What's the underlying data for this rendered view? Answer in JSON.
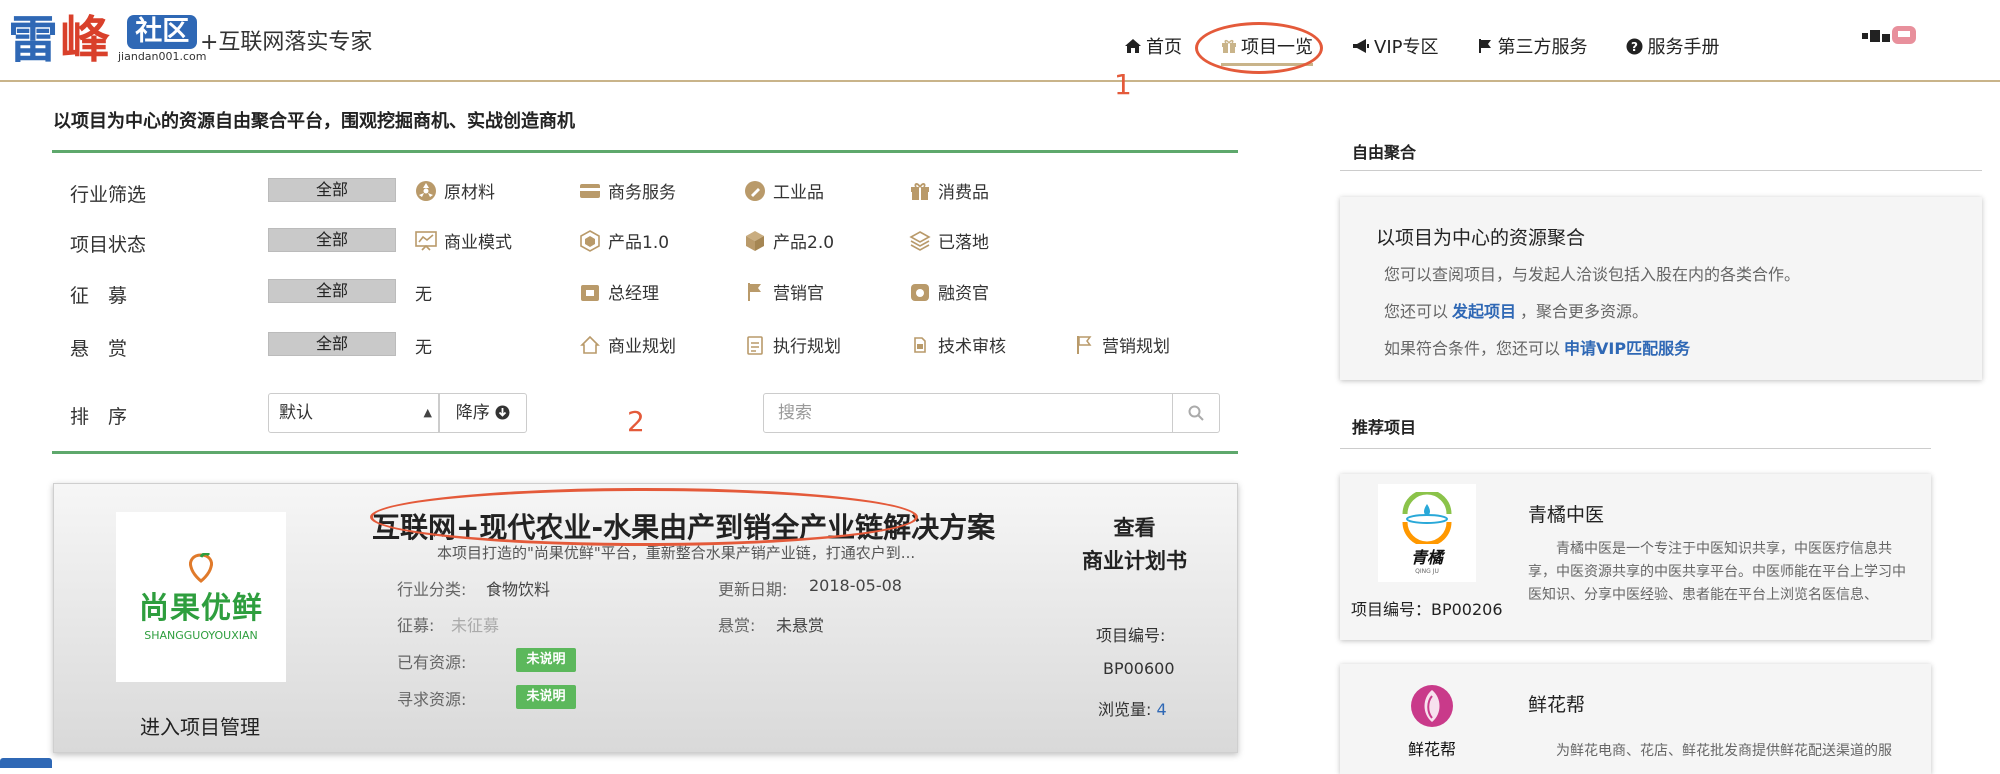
{
  "header": {
    "logo_char1": "雷",
    "logo_char2": "峰",
    "logo_box": "社区",
    "logo_url": "jiandan001.com",
    "slogan": "+互联网落实专家",
    "nav": [
      {
        "label": "首页",
        "icon": "home-icon"
      },
      {
        "label": "项目一览",
        "icon": "gift-icon"
      },
      {
        "label": "VIP专区",
        "icon": "megaphone-icon"
      },
      {
        "label": "第三方服务",
        "icon": "flag-icon"
      },
      {
        "label": "服务手册",
        "icon": "question-circle-icon"
      }
    ],
    "active_nav": "项目一览"
  },
  "annotations": {
    "num1": "1",
    "num2": "2",
    "color": "#e45a3a"
  },
  "main": {
    "tagline": "以项目为中心的资源自由聚合平台，围观挖掘商机、实战创造商机",
    "filters": {
      "all_label": "全部",
      "industry": {
        "label": "行业筛选",
        "options": [
          "原材料",
          "商务服务",
          "工业品",
          "消费品"
        ]
      },
      "status": {
        "label": "项目状态",
        "options": [
          "商业模式",
          "产品1.0",
          "产品2.0",
          "已落地"
        ]
      },
      "recruit": {
        "label": "征　募",
        "options": [
          "无",
          "总经理",
          "营销官",
          "融资官"
        ]
      },
      "reward": {
        "label": "悬　赏",
        "options": [
          "无",
          "商业规划",
          "执行规划",
          "技术审核",
          "营销规划"
        ]
      },
      "sort": {
        "label": "排　序",
        "select_value": "默认",
        "order_label": "降序"
      },
      "search_placeholder": "搜索"
    },
    "project": {
      "logo_cn": "尚果优鲜",
      "logo_en": "SHANGGUOYOUXIAN",
      "manage_label": "进入项目管理",
      "title": "互联网+现代农业-水果由产到销全产业链解决方案",
      "subtitle": "本项目打造的\"尚果优鲜\"平台，重新整合水果产销产业链，打通农户到...",
      "industry_key": "行业分类:",
      "industry_val": "食物饮料",
      "update_key": "更新日期:",
      "update_val": "2018-05-08",
      "recruit_key": "征募:",
      "recruit_val": "未征募",
      "reward_key": "悬赏:",
      "reward_val": "未悬赏",
      "have_key": "已有资源:",
      "have_tag": "未说明",
      "seek_key": "寻求资源:",
      "seek_tag": "未说明",
      "view_line1": "查看",
      "view_line2": "商业计划书",
      "code_key": "项目编号:",
      "code_val": "BP00600",
      "views_key": "浏览量:",
      "views_val": "4"
    }
  },
  "sidebar": {
    "section1_title": "自由聚合",
    "panel": {
      "title": "以项目为中心的资源聚合",
      "line1": "您可以查阅项目，与发起人洽谈包括入股在内的各类合作。",
      "line2_pre": "您还可以",
      "line2_link": "发起项目",
      "line2_post": "，聚合更多资源。",
      "line3_pre": "如果符合条件，您还可以",
      "line3_link": "申请VIP匹配服务"
    },
    "section2_title": "推荐项目",
    "rec1": {
      "logo_text": "青橘",
      "logo_sub": "QING JU",
      "name": "青橘中医",
      "desc": "青橘中医是一个专注于中医知识共享，中医医疗信息共享，中医资源共享的中医共享平台。中医师能在平台上学习中医知识、分享中医经验、患者能在平台上浏览名医信息、",
      "code": "项目编号：BP00206"
    },
    "rec2": {
      "logo_text": "鲜花帮",
      "name": "鲜花帮",
      "desc": "为鲜花电商、花店、鲜花批发商提供鲜花配送渠道的服"
    }
  }
}
